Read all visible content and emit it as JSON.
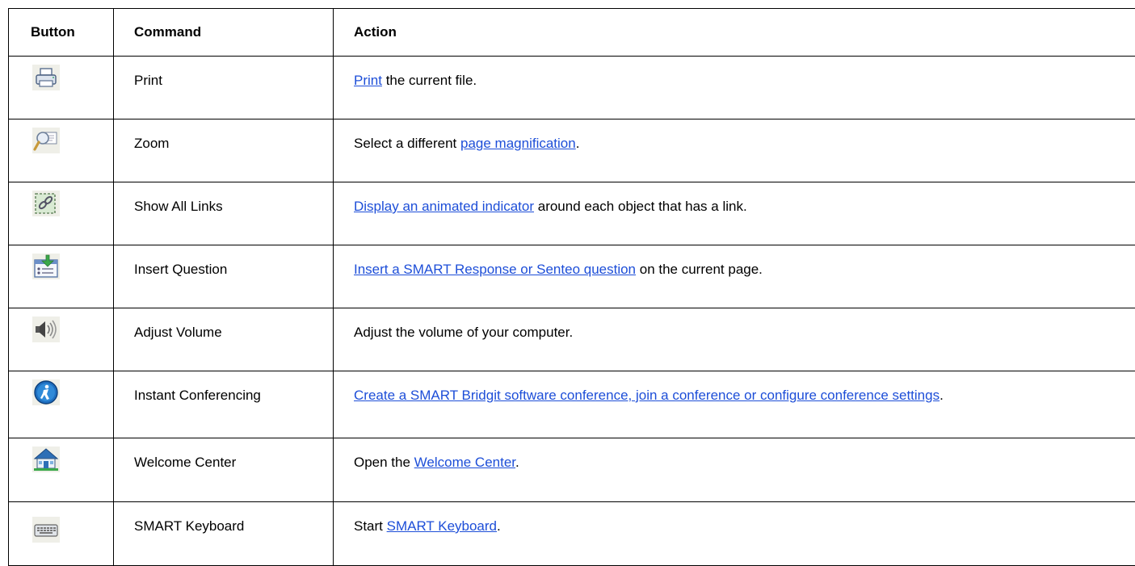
{
  "headers": {
    "button": "Button",
    "command": "Command",
    "action": "Action"
  },
  "rows": [
    {
      "icon": "printer-icon",
      "command": "Print",
      "pre": "",
      "link": "Print",
      "post": " the current file."
    },
    {
      "icon": "zoom-magnifier-icon",
      "command": "Zoom",
      "pre": "Select a different ",
      "link": "page magnification",
      "post": "."
    },
    {
      "icon": "link-indicator-icon",
      "command": "Show All Links",
      "pre": "",
      "link": "Display an animated indicator",
      "post": " around each object that has a link."
    },
    {
      "icon": "insert-question-icon",
      "command": "Insert Question",
      "pre": "",
      "link": "Insert a SMART Response or Senteo question",
      "post": " on the current page."
    },
    {
      "icon": "speaker-volume-icon",
      "command": "Adjust Volume",
      "pre": "Adjust the volume of your computer.",
      "link": "",
      "post": ""
    },
    {
      "icon": "conferencing-person-icon",
      "command": "Instant Conferencing",
      "pre": "",
      "link": "Create a SMART Bridgit software conference, join a conference or configure conference settings",
      "post": "."
    },
    {
      "icon": "welcome-center-house-icon",
      "command": "Welcome Center",
      "pre": "Open the ",
      "link": "Welcome Center",
      "post": "."
    },
    {
      "icon": "keyboard-icon",
      "command": "SMART Keyboard",
      "pre": "Start ",
      "link": "SMART Keyboard",
      "post": "."
    }
  ],
  "colors": {
    "link": "#1d4ed8",
    "border": "#000000"
  }
}
